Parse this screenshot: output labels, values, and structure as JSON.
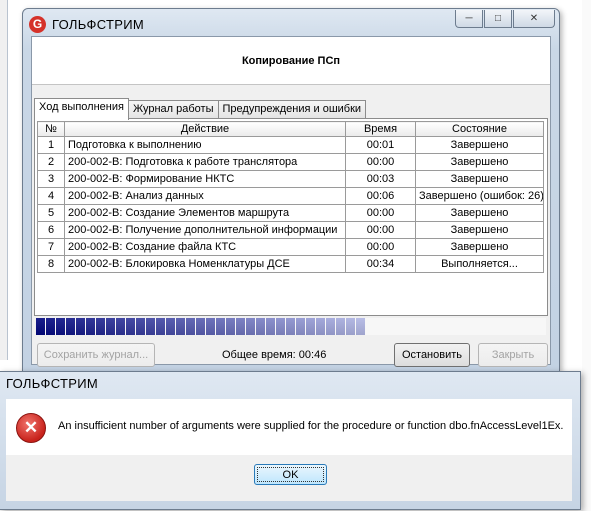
{
  "main_window": {
    "title": "ГОЛЬФСТРИМ",
    "logo_letter": "G",
    "header": "Копирование ПСп",
    "tabs": [
      {
        "label": "Ход выполнения",
        "active": true
      },
      {
        "label": "Журнал работы",
        "active": false
      },
      {
        "label": "Предупреждения и ошибки",
        "active": false
      }
    ],
    "table": {
      "columns": [
        "№",
        "Действие",
        "Время",
        "Состояние"
      ],
      "rows": [
        {
          "num": "1",
          "action": "Подготовка к выполнению",
          "time": "00:01",
          "status": "Завершено"
        },
        {
          "num": "2",
          "action": "200-002-В: Подготовка к работе транслятора",
          "time": "00:00",
          "status": "Завершено"
        },
        {
          "num": "3",
          "action": "200-002-В: Формирование НКТС",
          "time": "00:03",
          "status": "Завершено"
        },
        {
          "num": "4",
          "action": "200-002-В: Анализ данных",
          "time": "00:06",
          "status": "Завершено (ошибок: 26)"
        },
        {
          "num": "5",
          "action": "200-002-В: Создание Элементов маршрута",
          "time": "00:00",
          "status": "Завершено"
        },
        {
          "num": "6",
          "action": "200-002-В: Получение дополнительной информации",
          "time": "00:00",
          "status": "Завершено"
        },
        {
          "num": "7",
          "action": "200-002-В: Создание файла КТС",
          "time": "00:00",
          "status": "Завершено"
        },
        {
          "num": "8",
          "action": "200-002-В: Блокировка Номенклатуры ДСЕ",
          "time": "00:34",
          "status": "Выполняется..."
        }
      ]
    },
    "progress": {
      "filled_blocks": 33,
      "color_start": "#1a1f8c",
      "color_end": "#b8bde6"
    },
    "buttons": {
      "save_log": "Сохранить журнал...",
      "stop": "Остановить",
      "close": "Закрыть"
    },
    "total_time": "Общее время: 00:46"
  },
  "error_dialog": {
    "title": "ГОЛЬФСТРИМ",
    "icon": "error-x-icon",
    "message": "An insufficient number of arguments were supplied for the procedure or function dbo.fnAccessLevel1Ex.",
    "ok_label": "OK"
  }
}
